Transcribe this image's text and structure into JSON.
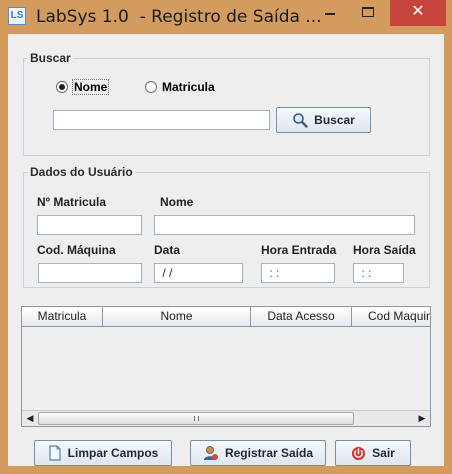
{
  "window": {
    "icon": "LS",
    "title": "LabSys 1.0  - Registro de Saída ...",
    "close_glyph": "✕"
  },
  "buscar": {
    "legend": "Buscar",
    "radio_nome": "Nome",
    "radio_matricula": "Matricula",
    "selected": "Nome",
    "search_value": "",
    "button": "Buscar",
    "button_icon": "magnifier-icon"
  },
  "dados": {
    "legend": "Dados do Usuário",
    "labels": {
      "matricula": "Nº Matricula",
      "nome": "Nome",
      "cod_maquina": "Cod. Máquina",
      "data": "Data",
      "hora_entrada": "Hora Entrada",
      "hora_saida": "Hora Saída"
    },
    "values": {
      "matricula": "",
      "nome": "",
      "cod_maquina": "",
      "data": " / /",
      "hora_entrada": " : :",
      "hora_saida": " : :"
    }
  },
  "table": {
    "columns": [
      "Matricula",
      "Nome",
      "Data Acesso",
      "Cod Maquina"
    ],
    "rows": []
  },
  "actions": {
    "limpar": "Limpar Campos",
    "registrar": "Registrar Saída",
    "sair": "Sair"
  },
  "colors": {
    "frame": "#d39b5e",
    "close": "#c7443d",
    "panel": "#eeeeee"
  }
}
